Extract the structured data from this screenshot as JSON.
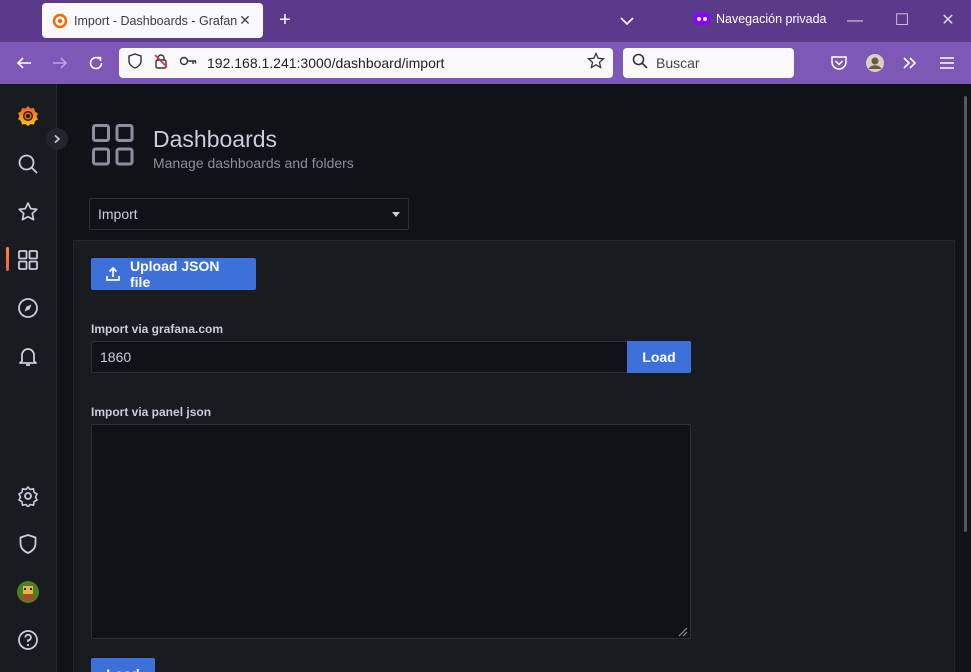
{
  "browser": {
    "tab": {
      "title": "Import - Dashboards - Grafana",
      "favicon": "grafana-icon"
    },
    "private_label": "Navegación privada",
    "url": "192.168.1.241:3000/dashboard/import",
    "search_placeholder": "Buscar",
    "colors": {
      "tabbar": "#5b3a8c",
      "navbar": "#7e58b7"
    }
  },
  "sidemenu": {
    "items": [
      {
        "name": "grafana-logo-icon"
      },
      {
        "name": "search-icon"
      },
      {
        "name": "star-icon"
      },
      {
        "name": "dashboards-icon",
        "active": true
      },
      {
        "name": "explore-compass-icon"
      },
      {
        "name": "alerting-bell-icon"
      },
      {
        "name": "gear-icon"
      },
      {
        "name": "shield-icon"
      },
      {
        "name": "avatar"
      },
      {
        "name": "help-icon"
      }
    ]
  },
  "header": {
    "title": "Dashboards",
    "subtitle": "Manage dashboards and folders"
  },
  "nav_select": {
    "value": "Import"
  },
  "import": {
    "upload_label": "Upload JSON file",
    "gcom_label": "Import via grafana.com",
    "gcom_value": "1860",
    "load_label": "Load",
    "panel_json_label": "Import via panel json",
    "panel_json_value": "",
    "load_label_2": "Load"
  },
  "colors": {
    "primary": "#3d71d9",
    "background": "#111217",
    "panel": "#181b1f",
    "text": "#ccccdc"
  }
}
